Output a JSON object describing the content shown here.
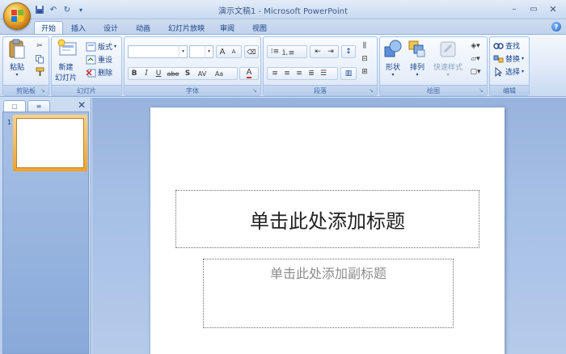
{
  "window": {
    "title": "演示文稿1 - Microsoft PowerPoint",
    "minimize_glyph": "–",
    "maximize_glyph": "▭",
    "close_glyph": "✕"
  },
  "qat": {
    "save_icon": "save-icon",
    "undo_glyph": "↶",
    "redo_glyph": "↻",
    "customize_glyph": "▾"
  },
  "tabs": [
    {
      "label": "开始",
      "active": true
    },
    {
      "label": "插入"
    },
    {
      "label": "设计"
    },
    {
      "label": "动画"
    },
    {
      "label": "幻灯片放映"
    },
    {
      "label": "审阅"
    },
    {
      "label": "视图"
    }
  ],
  "help_glyph": "?",
  "ribbon": {
    "clipboard": {
      "label": "剪贴板",
      "paste": "粘贴"
    },
    "slides": {
      "label": "幻灯片",
      "new_slide_line1": "新建",
      "new_slide_line2": "幻灯片",
      "layout": "版式",
      "reset": "重设",
      "delete": "删除"
    },
    "font": {
      "label": "字体",
      "bold": "B",
      "italic": "I",
      "underline": "U",
      "strike": "abe",
      "shadow": "S",
      "spacing": "AV",
      "case": "Aa",
      "color": "A",
      "grow": "A",
      "shrink": "A"
    },
    "paragraph": {
      "label": "段落"
    },
    "drawing": {
      "label": "绘图",
      "shapes": "形状",
      "arrange": "排列",
      "quick_styles": "快速样式"
    },
    "editing": {
      "label": "编辑",
      "find": "查找",
      "replace": "替换",
      "select": "选择"
    }
  },
  "left_panel": {
    "slides_tab_glyph": "▢",
    "outline_tab_glyph": "≡",
    "close_glyph": "✕",
    "slide_number": "1"
  },
  "slide": {
    "title_placeholder": "单击此处添加标题",
    "subtitle_placeholder": "单击此处添加副标题"
  },
  "colors": {
    "ribbon_text": "#15428b",
    "accent_orange": "#f2a12b",
    "workspace_blue": "#a5bfe5"
  }
}
